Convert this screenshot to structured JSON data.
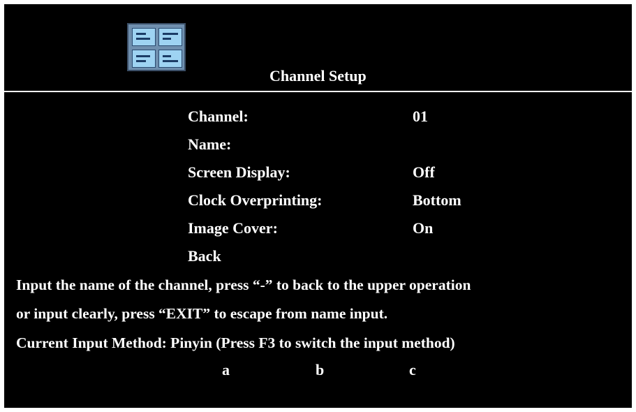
{
  "header": {
    "title": "Channel Setup",
    "icon": "grid-panel-icon"
  },
  "menu": {
    "items": [
      {
        "label": "Channel:",
        "value": "01"
      },
      {
        "label": "Name:",
        "value": ""
      },
      {
        "label": "Screen Display:",
        "value": "Off"
      },
      {
        "label": "Clock Overprinting:",
        "value": "Bottom"
      },
      {
        "label": "Image Cover:",
        "value": "On"
      },
      {
        "label": "Back",
        "value": ""
      }
    ]
  },
  "help": {
    "line1": "Input the name of the channel, press “-” to back to the upper operation",
    "line2": "or input clearly, press “EXIT” to escape from name input.",
    "line3": "Current Input Method: Pinyin (Press F3 to switch the input method)"
  },
  "input_candidates": [
    "a",
    "b",
    "c"
  ],
  "colors": {
    "background": "#000000",
    "text": "#ffffff",
    "icon_frame": "#6f8fae",
    "icon_pane": "#9ed3f2"
  }
}
